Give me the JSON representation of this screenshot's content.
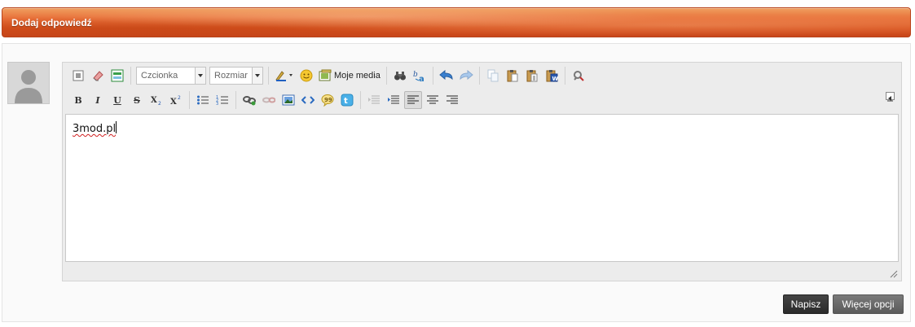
{
  "header": {
    "title": "Dodaj odpowiedź"
  },
  "toolbar": {
    "font_label": "Czcionka",
    "size_label": "Rozmiar",
    "media_label": "Moje media"
  },
  "editor": {
    "content": "3mod.pl"
  },
  "actions": {
    "submit": "Napisz",
    "more": "Więcej opcji"
  },
  "colors": {
    "header_orange": "#e8713a",
    "submit_bg": "#333333",
    "more_bg": "#666666"
  }
}
